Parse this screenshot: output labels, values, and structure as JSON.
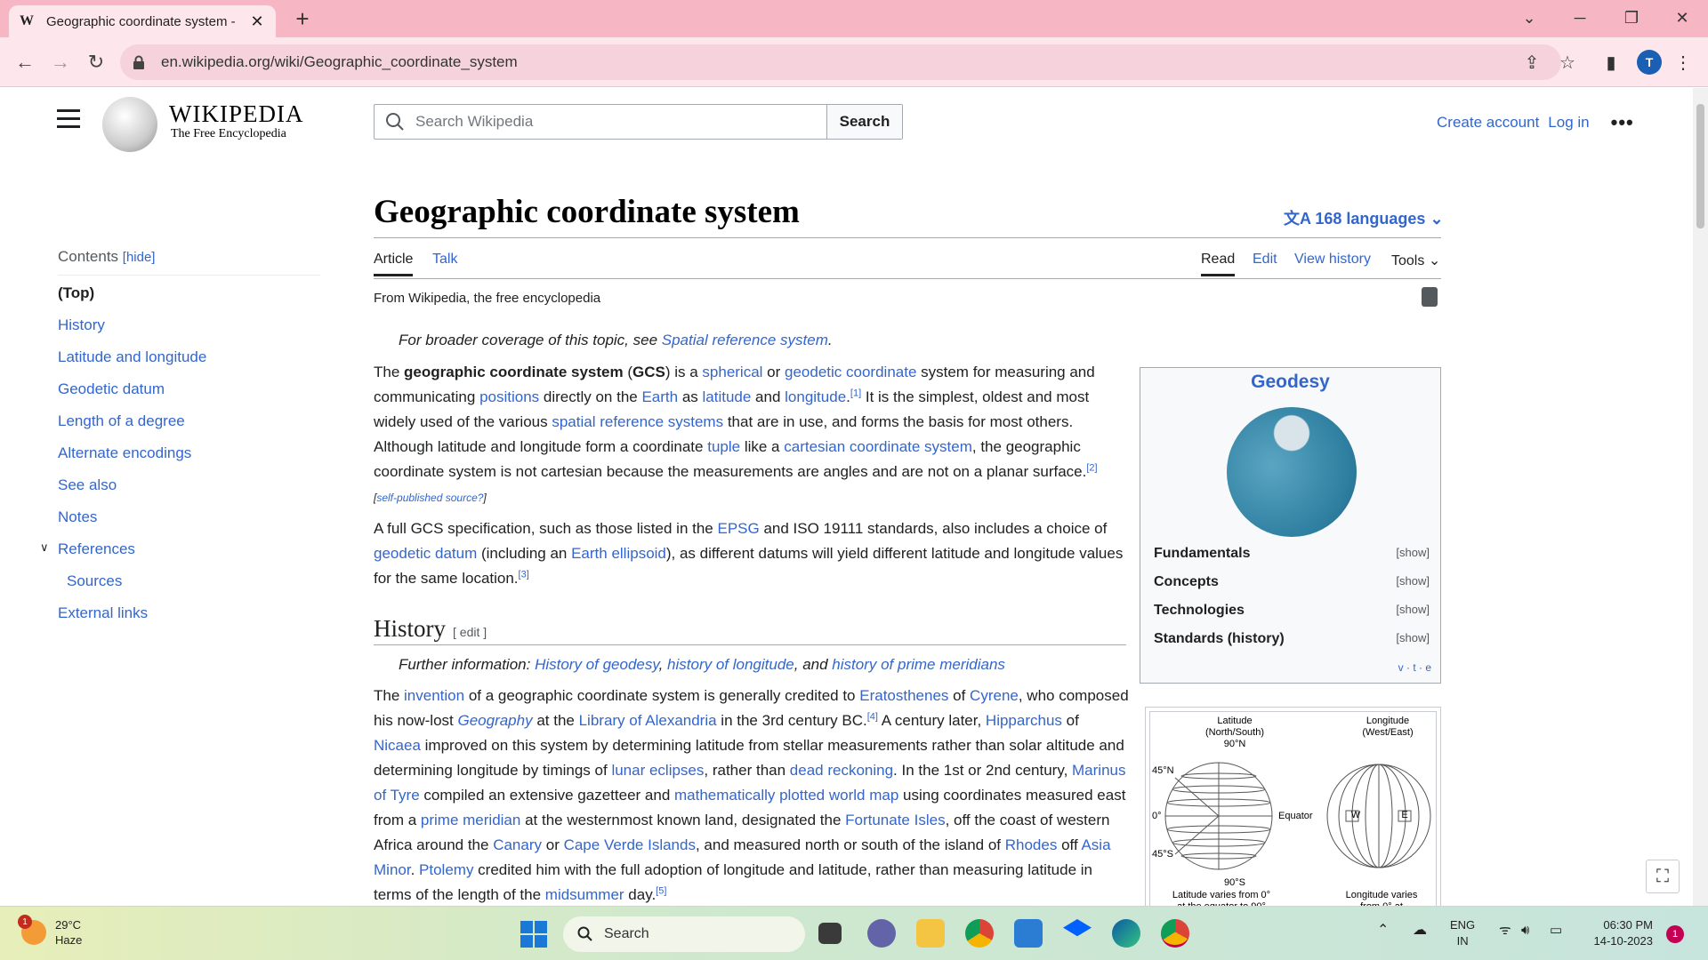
{
  "browser": {
    "tab_title": "Geographic coordinate system -",
    "tab_favicon": "W",
    "url": "en.wikipedia.org/wiki/Geographic_coordinate_system",
    "profile_initial": "T"
  },
  "header": {
    "wordmark": "WIKIPEDIA",
    "tagline": "The Free Encyclopedia",
    "search_placeholder": "Search Wikipedia",
    "search_button": "Search",
    "create_account": "Create account",
    "login": "Log in"
  },
  "toc": {
    "heading": "Contents",
    "hide": "[hide]",
    "items": [
      "(Top)",
      "History",
      "Latitude and longitude",
      "Geodetic datum",
      "Length of a degree",
      "Alternate encodings",
      "See also",
      "Notes",
      "References",
      "Sources",
      "External links"
    ]
  },
  "article": {
    "title": "Geographic coordinate system",
    "languages": "168 languages",
    "tabs": {
      "article": "Article",
      "talk": "Talk",
      "read": "Read",
      "edit": "Edit",
      "history": "View history",
      "tools": "Tools"
    },
    "from": "From Wikipedia, the free encyclopedia",
    "hatnote_prefix": "For broader coverage of this topic, see ",
    "hatnote_link": "Spatial reference system",
    "history_heading": "History",
    "edit_label": "[ edit ]",
    "further_prefix": "Further information: ",
    "further_links": [
      "History of geodesy",
      "history of longitude",
      "history of prime meridians"
    ],
    "further_and": ", and "
  },
  "infobox": {
    "title": "Geodesy",
    "rows": [
      "Fundamentals",
      "Concepts",
      "Technologies",
      "Standards (history)"
    ],
    "show": "[show]",
    "vte": "v · t · e"
  },
  "diagram": {
    "lat_title": "Latitude\n(North/South)",
    "lon_title": "Longitude\n(West/East)",
    "n90": "90°N",
    "n45": "45°N",
    "zero": "0°",
    "s45": "45°S",
    "s90": "90°S",
    "equator": "Equator",
    "w": "W",
    "e": "E",
    "lat_caption": "Latitude varies from 0°\nat the equator to 90°",
    "lon_caption": "Longitude varies\nfrom 0° at"
  },
  "taskbar": {
    "temp": "29°C",
    "weather": "Haze",
    "weather_badge": "1",
    "search": "Search",
    "lang1": "ENG",
    "lang2": "IN",
    "time": "06:30 PM",
    "date": "14-10-2023",
    "notifications": "1"
  }
}
